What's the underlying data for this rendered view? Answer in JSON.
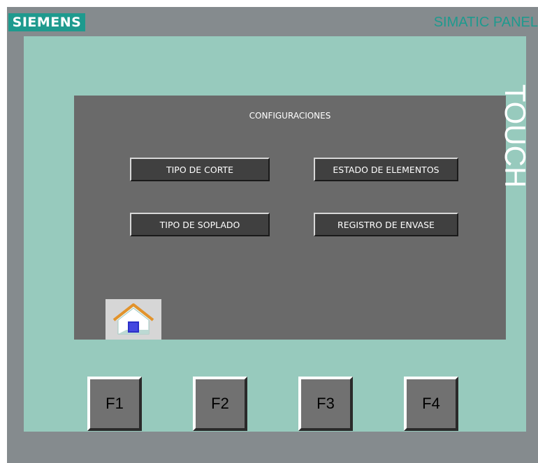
{
  "header": {
    "brand": "SIEMENS",
    "model": "SIMATIC PANEL",
    "side_label": "TOUCH"
  },
  "screen": {
    "title": "CONFIGURACIONES",
    "buttons": {
      "tipo_de_corte": "TIPO DE CORTE",
      "estado_de_elementos": "ESTADO DE ELEMENTOS",
      "tipo_de_soplado": "TIPO DE SOPLADO",
      "registro_de_envase": "REGISTRO DE ENVASE"
    },
    "home_icon": "home-icon"
  },
  "function_keys": [
    "F1",
    "F2",
    "F3",
    "F4"
  ],
  "colors": {
    "brand": "#1e9a8e",
    "bezel": "#97cabd",
    "housing": "#858b8e",
    "screen": "#6a6a6a",
    "button": "#404040"
  }
}
